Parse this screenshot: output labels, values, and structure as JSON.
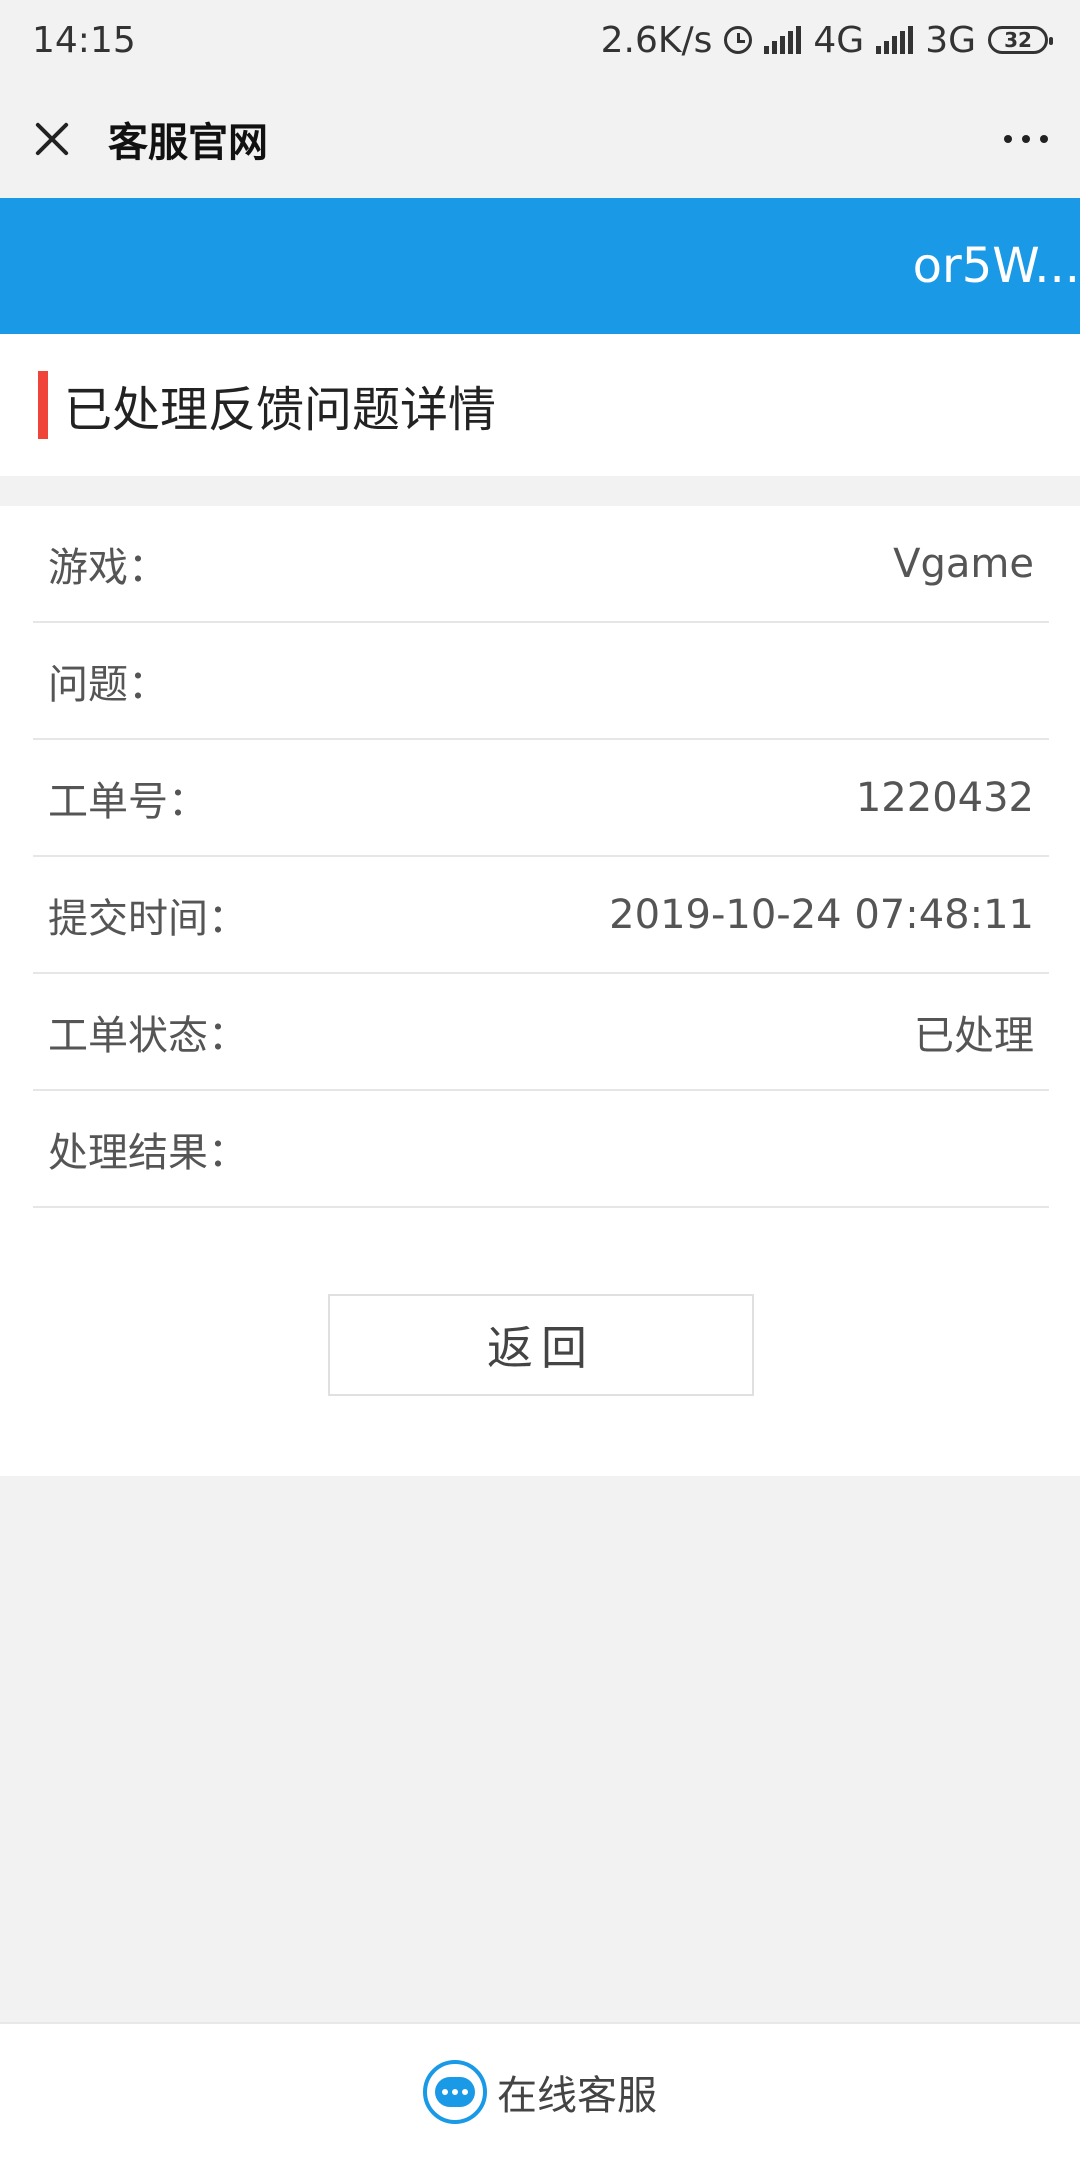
{
  "status_bar": {
    "time": "14:15",
    "speed": "2.6K/s",
    "net1": "4G",
    "net2": "3G",
    "battery": "32"
  },
  "title_bar": {
    "title": "客服官网"
  },
  "banner": {
    "text": "or5W..."
  },
  "section": {
    "heading": "已处理反馈问题详情"
  },
  "details": {
    "rows": [
      {
        "label": "游戏：",
        "value": "Vgame"
      },
      {
        "label": "问题：",
        "value": ""
      },
      {
        "label": "工单号：",
        "value": "1220432"
      },
      {
        "label": "提交时间：",
        "value": "2019-10-24 07:48:11"
      },
      {
        "label": "工单状态：",
        "value": "已处理"
      },
      {
        "label": "处理结果：",
        "value": ""
      }
    ],
    "back_label": "返回"
  },
  "bottom": {
    "label": "在线客服"
  },
  "colors": {
    "accent_blue": "#1999e6",
    "heading_bar_red": "#f0433a"
  }
}
